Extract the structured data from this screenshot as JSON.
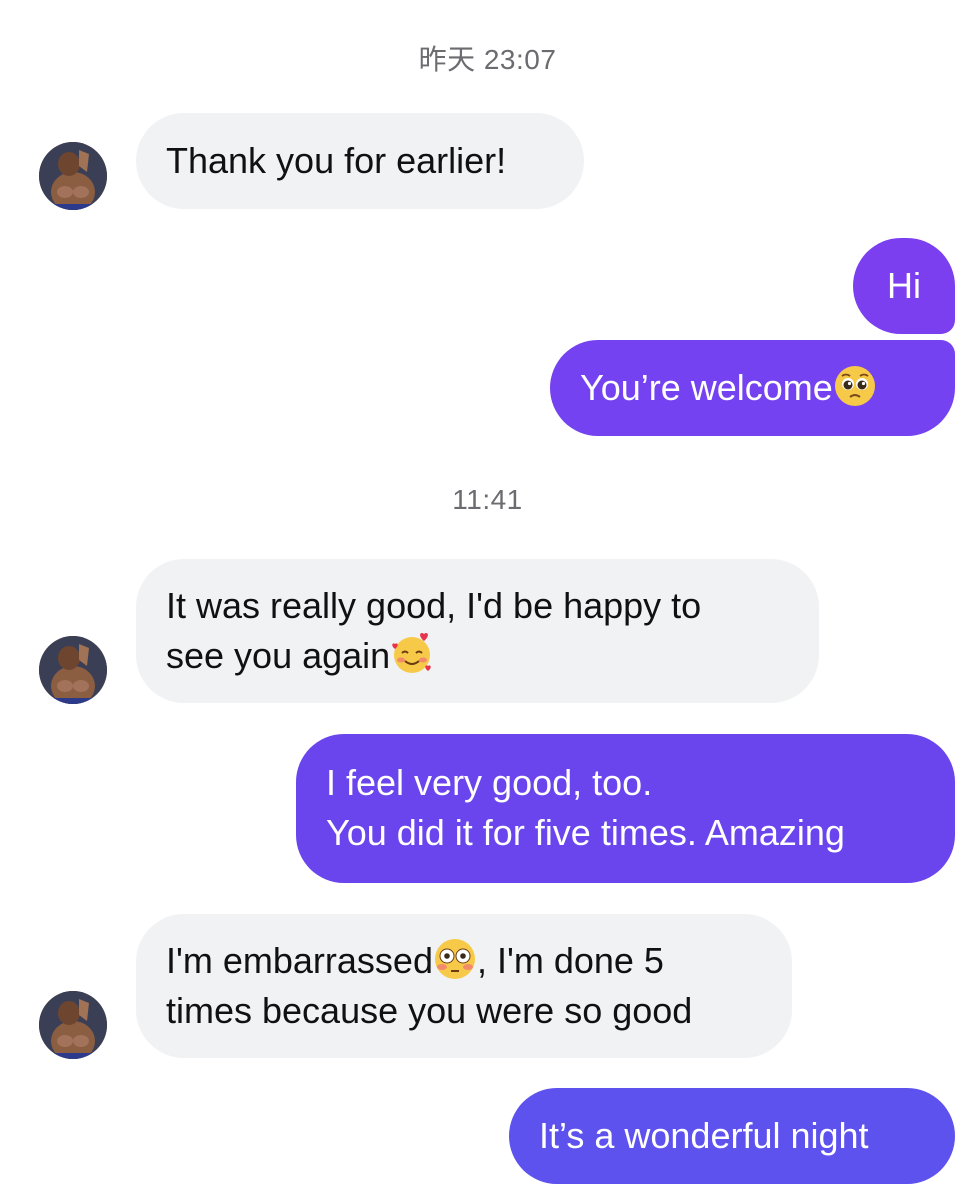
{
  "timestamps": {
    "first": "昨天 23:07",
    "second": "11:41"
  },
  "messages": {
    "m1": {
      "sender": "incoming",
      "text": "Thank you for earlier!"
    },
    "m2": {
      "sender": "outgoing",
      "text": "Hi"
    },
    "m3": {
      "sender": "outgoing",
      "text": "You’re welcome",
      "emoji": "pleading-face-emoji"
    },
    "m4": {
      "sender": "incoming",
      "line1": "It was really good, I'd be happy to",
      "line2": "see you again",
      "emoji": "smiling-face-with-hearts-emoji"
    },
    "m5": {
      "sender": "outgoing",
      "line1": "I feel very good, too.",
      "line2": "You did it for five times. Amazing"
    },
    "m6": {
      "sender": "incoming",
      "line1a": "I'm embarrassed",
      "line1b": ", I'm done 5",
      "line2": "times because you were so good",
      "emoji": "flushed-face-emoji"
    },
    "m7": {
      "sender": "outgoing",
      "text": "It’s a wonderful night"
    }
  },
  "colors": {
    "outgoing_top": "#7b3ff0",
    "outgoing_mid": "#6a45ee",
    "outgoing_bottom": "#5d52ee",
    "incoming_bg": "#f1f2f4",
    "timestamp": "#6b6b70"
  }
}
